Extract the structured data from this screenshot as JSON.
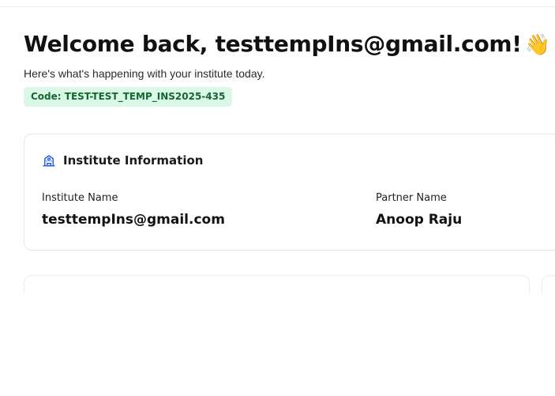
{
  "header": {
    "welcome_title": "Welcome back, testtempIns@gmail.com!",
    "wave_emoji": "👋",
    "subtitle": "Here's what's happening with your institute today.",
    "code_badge": "Code: TEST-TEST_TEMP_INS2025-435"
  },
  "institute_card": {
    "icon": "institute-building-icon",
    "title": "Institute Information",
    "fields": [
      {
        "label": "Institute Name",
        "value": "testtempIns@gmail.com"
      },
      {
        "label": "Partner Name",
        "value": "Anoop Raju"
      }
    ]
  },
  "colors": {
    "badge_bg": "#d9f8e6",
    "badge_text": "#166534",
    "icon_blue": "#2563eb"
  }
}
